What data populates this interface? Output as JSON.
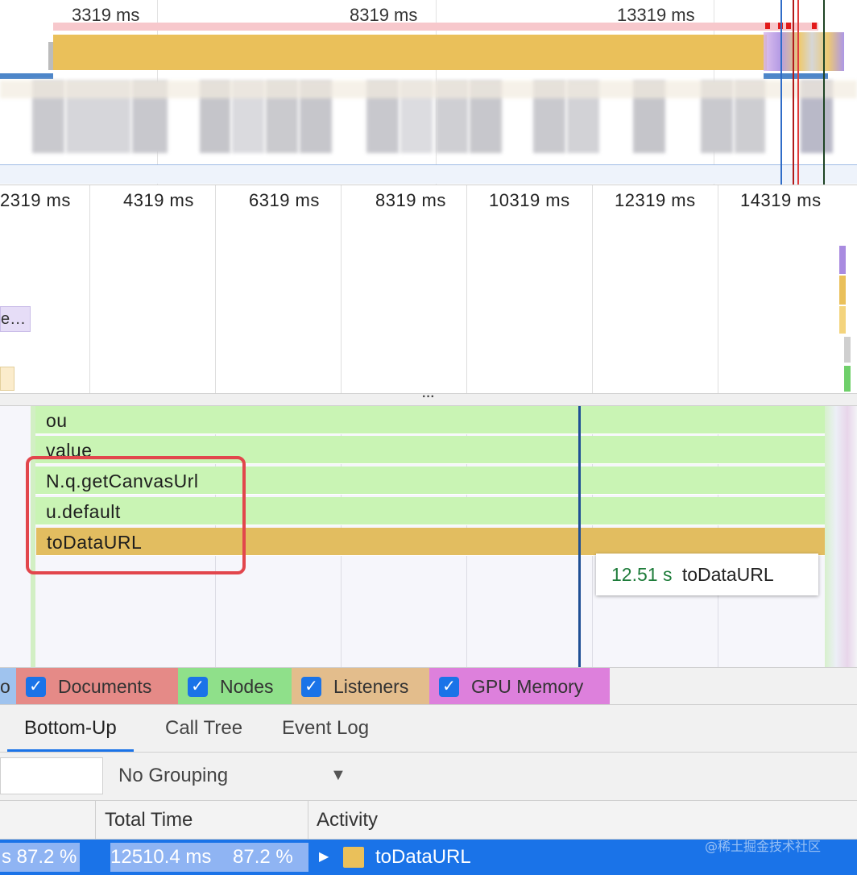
{
  "overview": {
    "ticks": [
      "3319 ms",
      "8319 ms",
      "13319 ms"
    ]
  },
  "ruler": {
    "ticks": [
      "2319 ms",
      "4319 ms",
      "6319 ms",
      "8319 ms",
      "10319 ms",
      "12319 ms",
      "14319 ms"
    ],
    "task_chip_label": "e…"
  },
  "splitter": {
    "label": "···"
  },
  "flame": {
    "frames": [
      "ou",
      "value",
      "N.q.getCanvasUrl",
      "u.default",
      "toDataURL"
    ],
    "tooltip": {
      "duration": "12.51 s",
      "name": "toDataURL"
    }
  },
  "counters": {
    "items": [
      {
        "label": "o",
        "checked": false
      },
      {
        "label": "Documents",
        "checked": true,
        "color": "#e58a87"
      },
      {
        "label": "Nodes",
        "checked": true,
        "color": "#8fe08a"
      },
      {
        "label": "Listeners",
        "checked": true,
        "color": "#e3bd8c"
      },
      {
        "label": "GPU Memory",
        "checked": true,
        "color": "#dd80dc"
      }
    ],
    "check_glyph": "✓"
  },
  "tabs": {
    "items": [
      "Bottom-Up",
      "Call Tree",
      "Event Log"
    ],
    "active": "Bottom-Up"
  },
  "toolbar": {
    "filter_value": "",
    "grouping": "No Grouping",
    "dropdown_glyph": "▼"
  },
  "table": {
    "headers": {
      "total_time": "Total Time",
      "activity": "Activity"
    },
    "rows": [
      {
        "self_pct_partial": "s  87.2 %",
        "total_time": "12510.4 ms",
        "total_pct": "87.2 %",
        "expand_glyph": "▶",
        "activity": "toDataURL",
        "activity_color": "#eac05a",
        "total_pct_value": 87.2
      }
    ]
  },
  "watermark": "@稀土掘金技术社区"
}
